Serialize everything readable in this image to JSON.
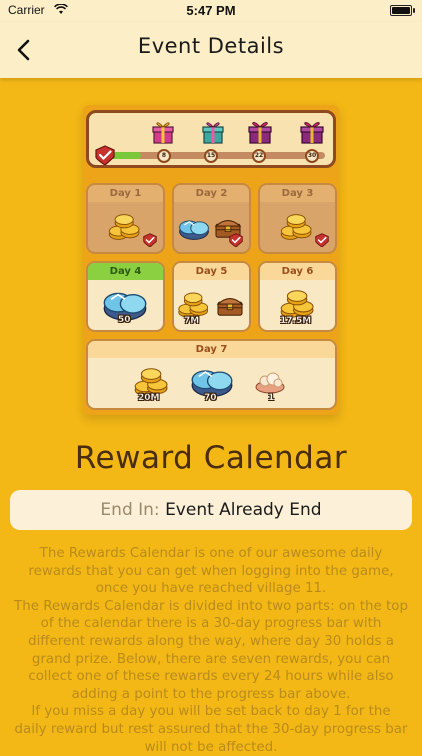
{
  "status_bar": {
    "carrier": "Carrier",
    "time": "5:47 PM"
  },
  "nav": {
    "title": "Event Details"
  },
  "progress": {
    "milestones": [
      "8",
      "15",
      "22",
      "30"
    ],
    "fill_fraction": 0.17
  },
  "days": [
    {
      "label": "Day 1",
      "amounts": []
    },
    {
      "label": "Day 2",
      "amounts": []
    },
    {
      "label": "Day 3",
      "amounts": []
    },
    {
      "label": "Day 4",
      "amounts": [
        "50"
      ]
    },
    {
      "label": "Day 5",
      "amounts": [
        "7M"
      ]
    },
    {
      "label": "Day 6",
      "amounts": [
        "17.5M"
      ]
    },
    {
      "label": "Day 7",
      "amounts": [
        "20M",
        "70",
        "1"
      ]
    }
  ],
  "reward_title": "Reward Calendar",
  "end": {
    "label": "End In:",
    "value": "Event Already End"
  },
  "description": {
    "p1": "The Rewards Calendar is one of our awesome daily rewards that you can get when logging into the game, once you have reached village 11.",
    "p2": "The Rewards Calendar is divided into two parts: on the top of the calendar there is a 30-day progress bar with different rewards along the way, where day 30 holds a grand prize. Below, there are seven rewards, you can collect one of these rewards every 24 hours while also adding a point to the progress bar above.",
    "p3": "If you miss a day you will be set back to day 1 for the daily reward but rest assured that the 30-day progress bar will not be affected."
  },
  "colors": {
    "background": "#F3B816",
    "header": "#FCEFC8",
    "text_dark": "#4A2C0E",
    "description": "#B88B1C"
  }
}
